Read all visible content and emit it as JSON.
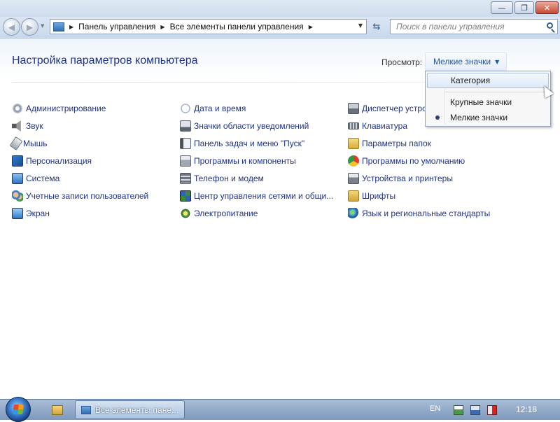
{
  "window": {
    "buttons": {
      "minimize": "—",
      "maximize": "❐",
      "close": "✕"
    }
  },
  "nav": {
    "back_glyph": "◀",
    "forward_glyph": "▶",
    "dropdown_glyph": "▼",
    "breadcrumb": [
      "Панель управления",
      "Все элементы панели управления"
    ],
    "arrow_glyph": "▶",
    "refresh_glyph": "⇆"
  },
  "search": {
    "placeholder": "Поиск в панели управления"
  },
  "header": {
    "title": "Настройка параметров компьютера",
    "view_label": "Просмотр:",
    "view_value": "Мелкие значки"
  },
  "items": {
    "col1": [
      "Администрирование",
      "Звук",
      "Мышь",
      "Персонализация",
      "Система",
      "Учетные записи пользователей",
      "Экран"
    ],
    "col2": [
      "Дата и время",
      "Значки области уведомлений",
      "Панель задач и меню \"Пуск\"",
      "Программы и компоненты",
      "Телефон и модем",
      "Центр управления сетями и общи...",
      "Электропитание"
    ],
    "col3": [
      "Диспетчер устро",
      "Клавиатура",
      "Параметры папок",
      "Программы по умолчанию",
      "Устройства и принтеры",
      "Шрифты",
      "Язык и региональные стандарты"
    ]
  },
  "view_menu": {
    "options": [
      "Категория",
      "Крупные значки",
      "Мелкие значки"
    ],
    "selected": "Мелкие значки"
  },
  "taskbar": {
    "window_label": "Все элементы пане...",
    "language": "EN",
    "clock": "12:18"
  },
  "colors": {
    "link": "#1e3287",
    "title": "#1e3287",
    "taskbar": "#7e99bc"
  },
  "icons": {
    "col1": [
      "admin-tools-icon",
      "sound-icon",
      "mouse-icon",
      "personalization-icon",
      "system-icon",
      "user-accounts-icon",
      "display-icon"
    ],
    "col2": [
      "clock-icon",
      "notification-area-icon",
      "taskbar-icon",
      "programs-icon",
      "phone-modem-icon",
      "network-center-icon",
      "power-icon"
    ],
    "col3": [
      "device-manager-icon",
      "keyboard-icon",
      "folder-options-icon",
      "default-programs-icon",
      "devices-printers-icon",
      "fonts-icon",
      "region-icon"
    ]
  }
}
